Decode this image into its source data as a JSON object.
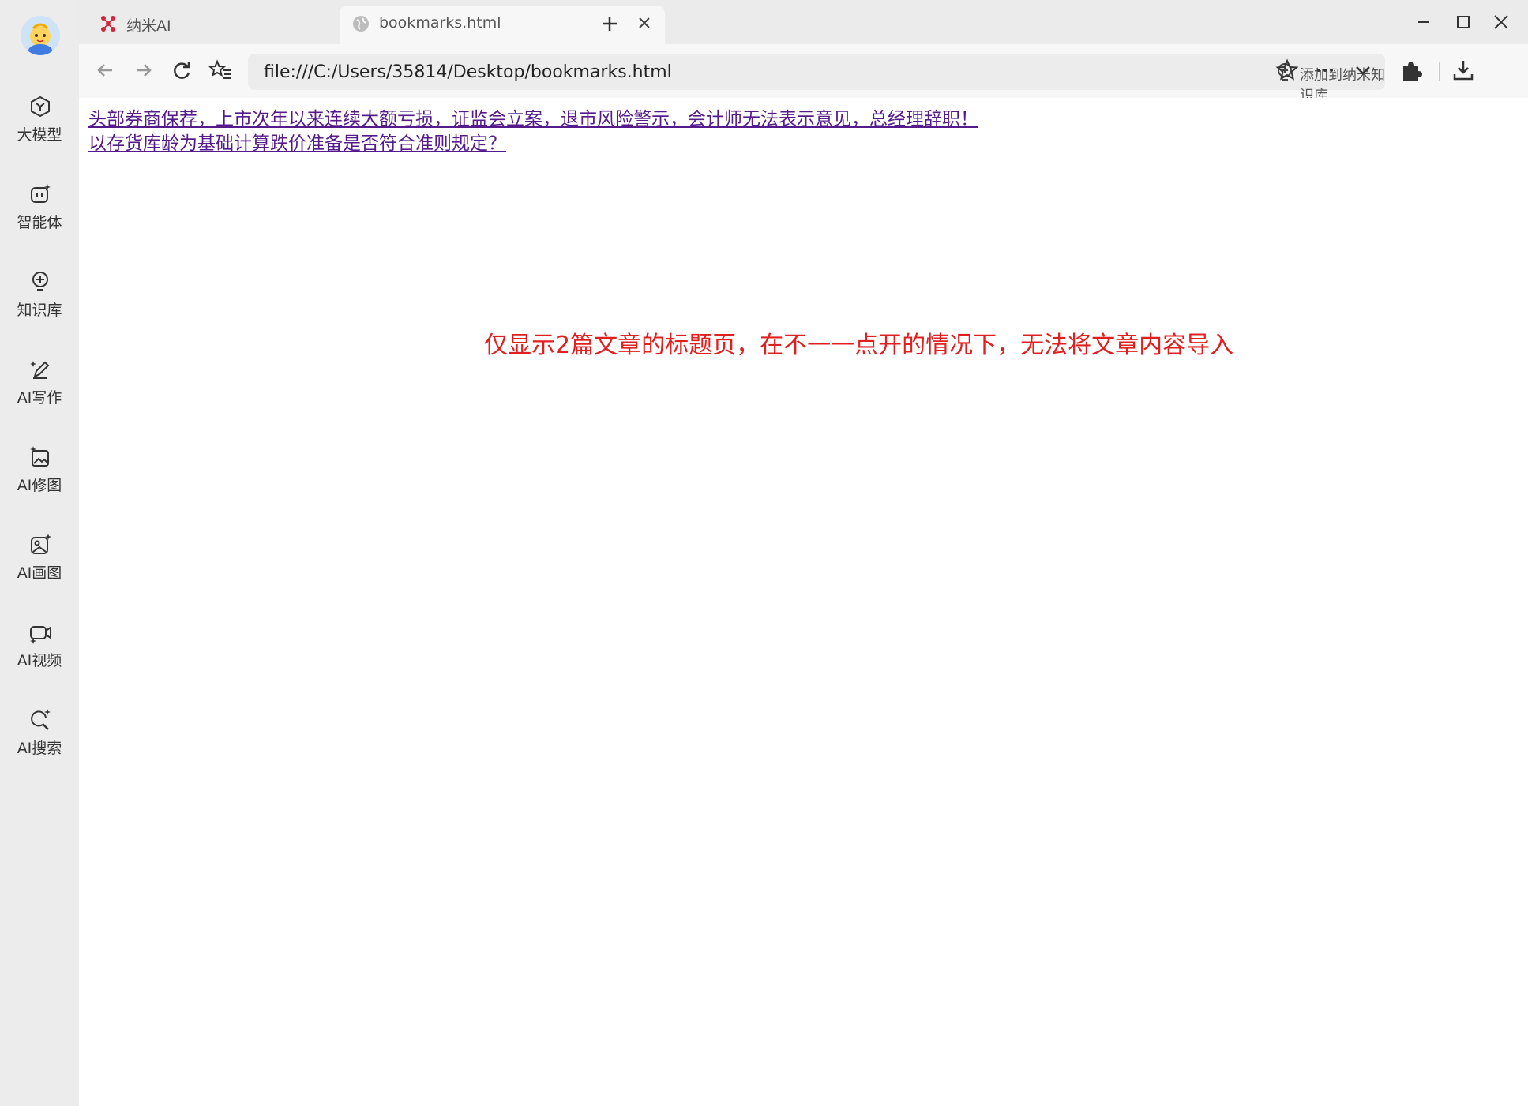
{
  "sidebar": {
    "items": [
      {
        "label": "大模型",
        "icon": "hexagon-model-icon"
      },
      {
        "label": "智能体",
        "icon": "agent-face-icon"
      },
      {
        "label": "知识库",
        "icon": "lightbulb-icon"
      },
      {
        "label": "AI写作",
        "icon": "pen-write-icon"
      },
      {
        "label": "AI修图",
        "icon": "image-edit-icon"
      },
      {
        "label": "AI画图",
        "icon": "image-draw-icon"
      },
      {
        "label": "AI视频",
        "icon": "video-icon"
      },
      {
        "label": "AI搜索",
        "icon": "search-spark-icon"
      }
    ]
  },
  "tabs": [
    {
      "title": "纳米AI",
      "active": false
    },
    {
      "title": "bookmarks.html",
      "active": true
    }
  ],
  "toolbar": {
    "url": "file:///C:/Users/35814/Desktop/bookmarks.html",
    "add_to_kb": "添加到纳米知识库"
  },
  "page": {
    "links": [
      "头部券商保荐，上市次年以来连续大额亏损，证监会立案，退市风险警示，会计师无法表示意见，总经理辞职！",
      "以存货库龄为基础计算跌价准备是否符合准则规定？"
    ],
    "annotation": "仅显示2篇文章的标题页，在不一一点开的情况下，无法将文章内容导入"
  },
  "colors": {
    "link_visited": "#551a8b",
    "annotation": "#e02020",
    "brand_red": "#d0253a"
  }
}
